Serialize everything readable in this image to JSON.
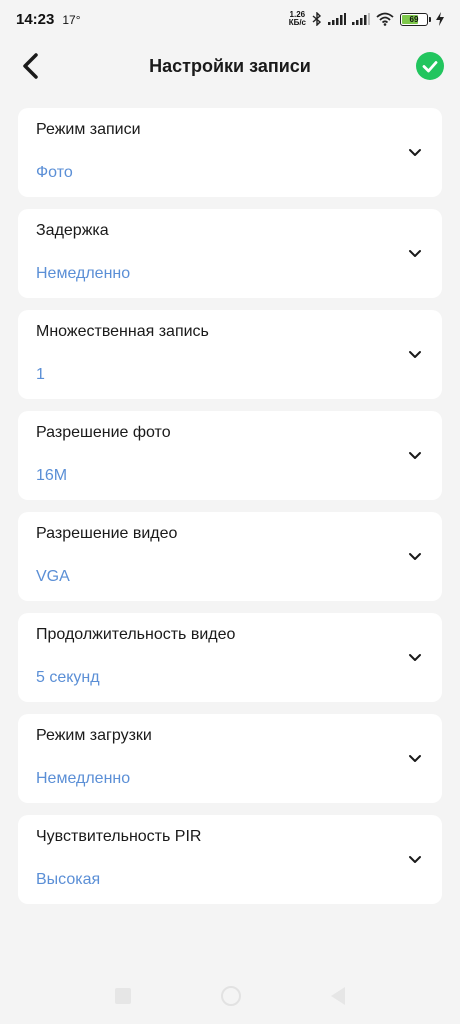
{
  "status_bar": {
    "time": "14:23",
    "temperature": "17°",
    "net_speed_value": "1.26",
    "net_speed_unit": "КБ/с",
    "battery_level": "69",
    "battery_fraction": 0.69
  },
  "header": {
    "title": "Настройки записи",
    "back_icon": "chevron-left-icon",
    "confirm_icon": "check-circle-icon",
    "confirm_color": "#22c55e"
  },
  "colors": {
    "value_text": "#5b8fd6",
    "card_bg": "#ffffff",
    "page_bg": "#f4f4f4"
  },
  "settings": [
    {
      "label": "Режим записи",
      "value": "Фото"
    },
    {
      "label": "Задержка",
      "value": "Немедленно"
    },
    {
      "label": "Множественная запись",
      "value": "1"
    },
    {
      "label": "Разрешение фото",
      "value": "16M"
    },
    {
      "label": "Разрешение видео",
      "value": "VGA"
    },
    {
      "label": "Продолжительность видео",
      "value": "5 секунд"
    },
    {
      "label": "Режим загрузки",
      "value": "Немедленно"
    },
    {
      "label": "Чувствительность PIR",
      "value": "Высокая"
    }
  ]
}
